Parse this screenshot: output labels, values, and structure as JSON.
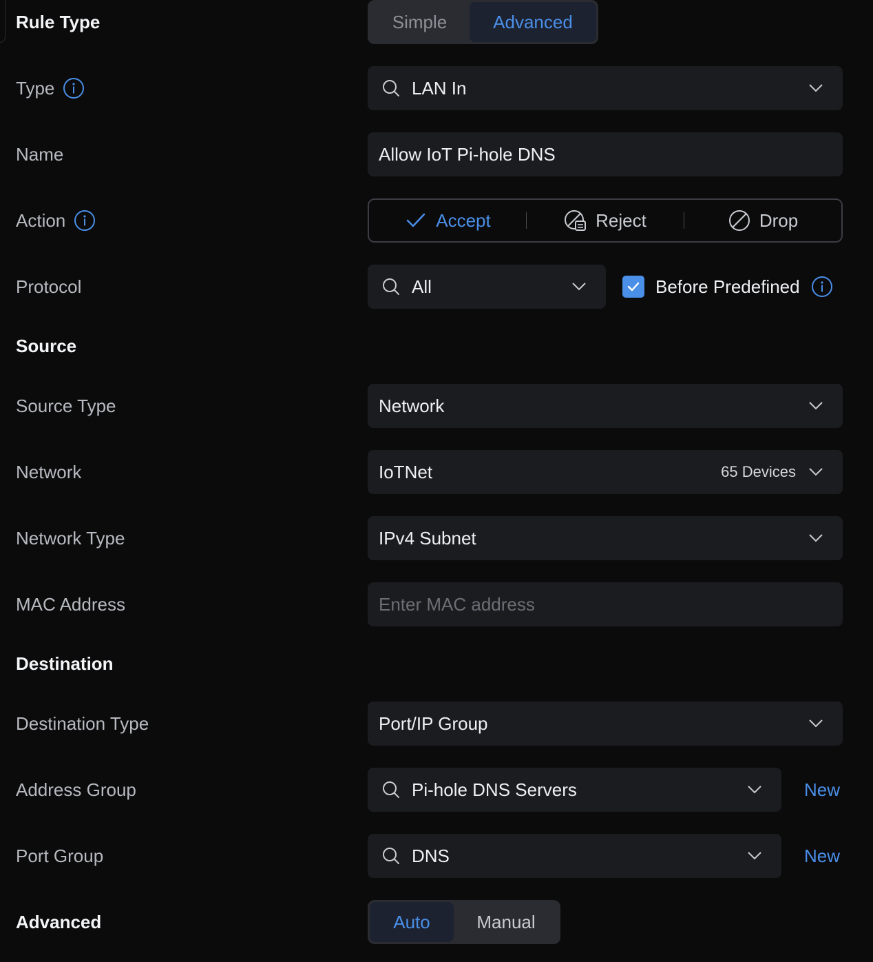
{
  "colors": {
    "accent": "#4a8fe8",
    "background": "#0b0b0c",
    "field": "#1b1c1f"
  },
  "rule_type": {
    "label": "Rule Type",
    "options": [
      "Simple",
      "Advanced"
    ],
    "selected": "Advanced"
  },
  "type": {
    "label": "Type",
    "value": "LAN In"
  },
  "name": {
    "label": "Name",
    "value": "Allow IoT Pi-hole DNS"
  },
  "action": {
    "label": "Action",
    "options": [
      "Accept",
      "Reject",
      "Drop"
    ],
    "selected": "Accept"
  },
  "protocol": {
    "label": "Protocol",
    "value": "All",
    "before_predefined_label": "Before Predefined",
    "before_predefined_checked": true
  },
  "source": {
    "heading": "Source",
    "source_type": {
      "label": "Source Type",
      "value": "Network"
    },
    "network": {
      "label": "Network",
      "value": "IoTNet",
      "devices": "65 Devices"
    },
    "network_type": {
      "label": "Network Type",
      "value": "IPv4 Subnet"
    },
    "mac_address": {
      "label": "MAC Address",
      "value": "",
      "placeholder": "Enter MAC address"
    }
  },
  "destination": {
    "heading": "Destination",
    "destination_type": {
      "label": "Destination Type",
      "value": "Port/IP Group"
    },
    "address_group": {
      "label": "Address Group",
      "value": "Pi-hole DNS Servers",
      "new_label": "New"
    },
    "port_group": {
      "label": "Port Group",
      "value": "DNS",
      "new_label": "New"
    }
  },
  "advanced": {
    "label": "Advanced",
    "options": [
      "Auto",
      "Manual"
    ],
    "selected": "Auto"
  }
}
